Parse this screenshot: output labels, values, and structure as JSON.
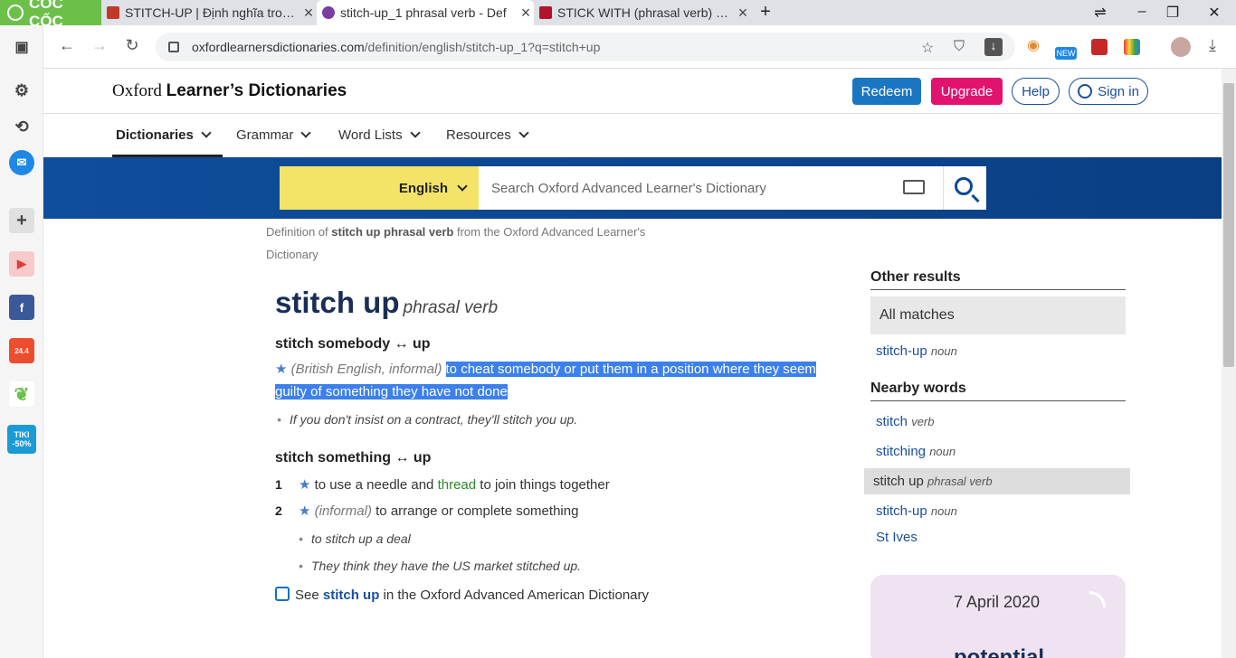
{
  "browser": {
    "brand": "CỐC CỐC",
    "tabs": [
      {
        "title": "STITCH-UP | Định nghĩa trong",
        "active": false,
        "color": "#c0392b"
      },
      {
        "title": "stitch-up_1 phrasal verb - Def",
        "active": true,
        "color": "#7a3ea0"
      },
      {
        "title": "STICK WITH (phrasal verb) de",
        "active": false,
        "color": "#b3122d"
      }
    ],
    "new_tab": "+",
    "url_host": "oxfordlearnersdictionaries.com",
    "url_path": "/definition/english/stitch-up_1?q=stitch+up",
    "new_badge": "NEW"
  },
  "sidebar": {
    "tiki_label": "TIKI -50%",
    "shopee_label": "24.4"
  },
  "site": {
    "logo_oxford": "Oxford ",
    "logo_rest": "Learner’s Dictionaries",
    "redeem": "Redeem",
    "upgrade": "Upgrade",
    "help": "Help",
    "sign_in": "Sign in",
    "nav": [
      "Dictionaries",
      "Grammar",
      "Word Lists",
      "Resources"
    ]
  },
  "search": {
    "language": "English",
    "placeholder": "Search Oxford Advanced Learner's Dictionary"
  },
  "breadcrumb": {
    "prefix": "Definition of ",
    "term": "stitch up phrasal verb",
    "suffix": " from the Oxford Advanced Learner's Dictionary"
  },
  "entry": {
    "headword": "stitch up",
    "pos": "phrasal verb",
    "sense1": {
      "head": "stitch somebody ↔ up",
      "labels": "(British English, informal)",
      "definition": "to cheat somebody or put them in a position where they seem guilty of something they have not done",
      "example": "If you don't insist on a contract, they'll stitch you up."
    },
    "sense2": {
      "head": "stitch something ↔ up",
      "items": [
        {
          "num": "1",
          "pre": "to use a needle and ",
          "link": "thread",
          "post": " to join things together"
        },
        {
          "num": "2",
          "labels": "(informal)",
          "definition": " to arrange or complete something"
        }
      ],
      "examples": [
        "to stitch up a deal",
        "They think they have the US market stitched up."
      ]
    },
    "see_pre": "See ",
    "see_link": "stitch up",
    "see_post": " in the Oxford Advanced American Dictionary"
  },
  "side": {
    "other_title": "Other results",
    "all_matches": "All matches",
    "other_items": [
      {
        "word": "stitch-up",
        "pos": "noun"
      }
    ],
    "nearby_title": "Nearby words",
    "nearby_items": [
      {
        "word": "stitch",
        "pos": "verb"
      },
      {
        "word": "stitching",
        "pos": "noun"
      },
      {
        "word": "stitch up",
        "pos": "phrasal verb"
      },
      {
        "word": "stitch-up",
        "pos": "noun"
      },
      {
        "word": "St Ives",
        "pos": ""
      }
    ],
    "wotd_date": "7 April 2020",
    "wotd_word": "potential"
  },
  "colors": {
    "redeem": "#1b76c2",
    "upgrade": "#e2136e",
    "search_band": "#0f4e9c",
    "lang_bg": "#f3e469",
    "selection": "#3c80ec"
  }
}
